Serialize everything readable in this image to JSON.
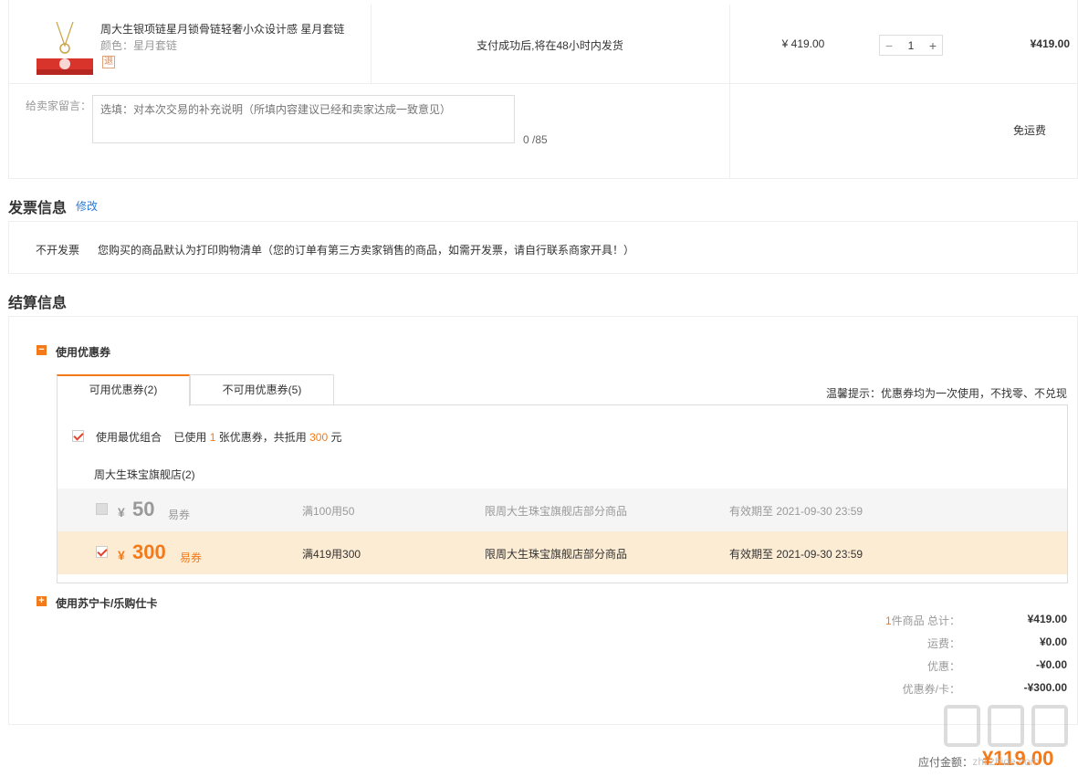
{
  "product": {
    "name": "周大生银项链星月锁骨链轻奢小众设计感 星月套链",
    "color_label": "颜色：星月套链",
    "return_tag": "退",
    "shipping_note": "支付成功后,将在48小时内发货",
    "unit_price": "¥ 419.00",
    "quantity": "1",
    "qty_minus": "−",
    "qty_plus": "+",
    "line_total": "¥419.00"
  },
  "message": {
    "label": "给卖家留言：",
    "placeholder": "选填：对本次交易的补充说明（所填内容建议已经和卖家达成一致意见）",
    "count": "0 /85",
    "free_shipping": "免运费"
  },
  "invoice": {
    "title": "发票信息",
    "edit": "修改",
    "type": "不开发票",
    "desc": "您购买的商品默认为打印购物清单（您的订单有第三方卖家销售的商品，如需开发票，请自行联系商家开具！）"
  },
  "settlement": {
    "title": "结算信息",
    "coupon_toggle": "−",
    "coupon_title": "使用优惠券",
    "tabs": [
      "可用优惠券(2)",
      "不可用优惠券(5)"
    ],
    "tip": "温馨提示：优惠券均为一次使用，不找零、不兑现",
    "best_combo": "使用最优组合",
    "used_prefix": "已使用",
    "used_count": "1",
    "used_mid": "张优惠券，共抵用",
    "used_amount": "300",
    "used_suffix": "元",
    "store": "周大生珠宝旗舰店(2)",
    "coupons": [
      {
        "yen": "¥",
        "amount": "50",
        "kind": "易券",
        "rule": "满100用50",
        "scope": "限周大生珠宝旗舰店部分商品",
        "expiry": "有效期至 2021-09-30 23:59"
      },
      {
        "yen": "¥",
        "amount": "300",
        "kind": "易券",
        "rule": "满419用300",
        "scope": "限周大生珠宝旗舰店部分商品",
        "expiry": "有效期至 2021-09-30 23:59"
      }
    ],
    "card_toggle": "+",
    "card_title": "使用苏宁卡/乐购仕卡",
    "summary": {
      "count": "1",
      "items_label": "件商品 总计：",
      "items_total": "¥419.00",
      "shipping_label": "运费：",
      "shipping": "¥0.00",
      "discount_label": "优惠：",
      "discount": "-¥0.00",
      "coupon_label": "优惠券/卡：",
      "coupon": "-¥300.00"
    },
    "pay_label": "应付金额：",
    "pay_total": "¥119.00"
  },
  "watermark": {
    "text": "值",
    "site": "zhi.zhide.com"
  },
  "colors": {
    "accent": "#f27a1a",
    "link": "#2b7bd5",
    "selected_row": "#fdecd4"
  }
}
